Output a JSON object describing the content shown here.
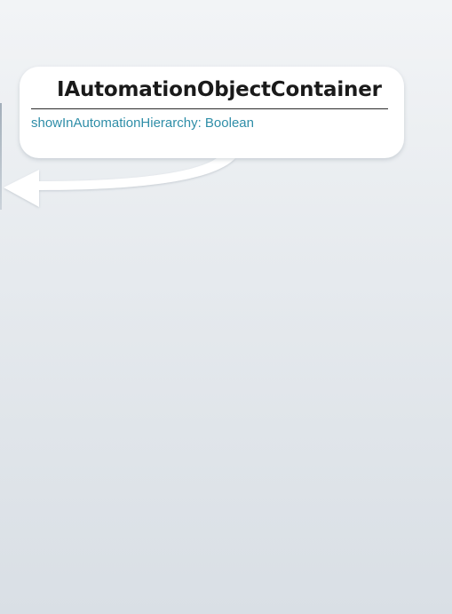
{
  "diagram": {
    "class_box": {
      "title": "IAutomationObjectContainer",
      "property": "showInAutomationHierarchy: Boolean"
    },
    "connector": {
      "type": "inheritance-arrow",
      "direction": "left",
      "color": "#ffffff"
    },
    "background": {
      "top_color": "#f2f4f6",
      "bottom_color": "#d9dfe5"
    }
  }
}
